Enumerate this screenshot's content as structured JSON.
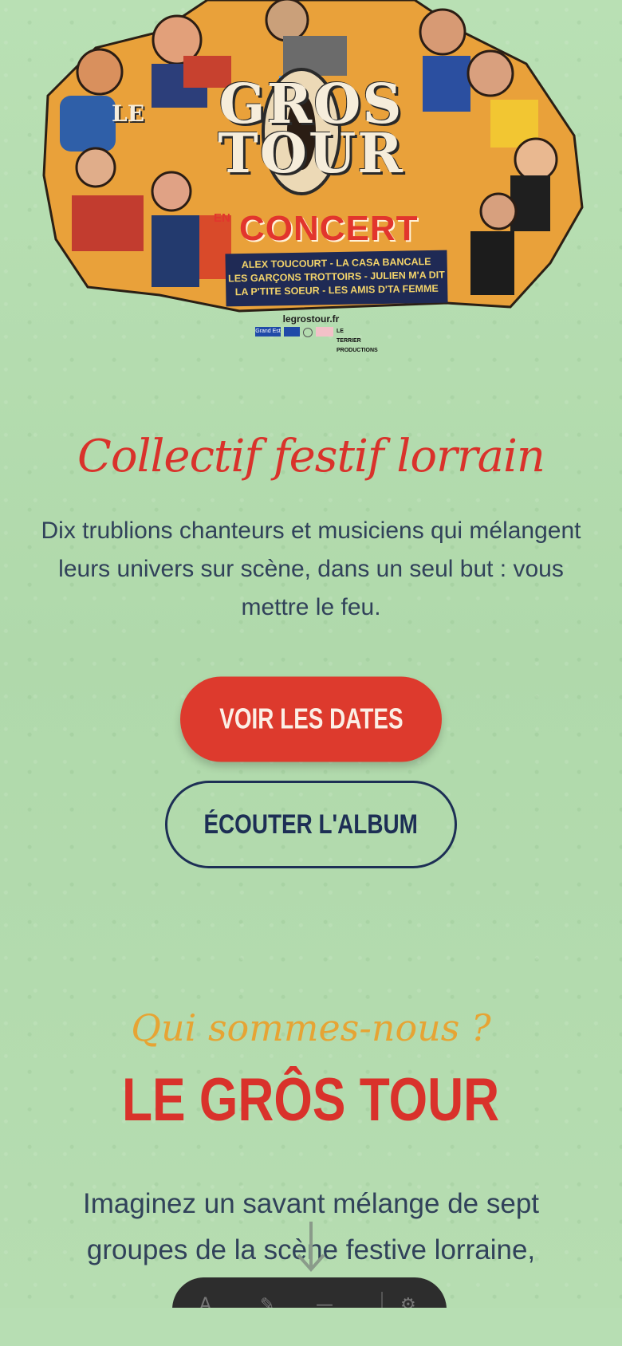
{
  "poster": {
    "title_le": "LE",
    "title_line1": "GROS",
    "title_line2": "TOUR",
    "concert_en": "EN",
    "concert": "CONCERT",
    "bands": [
      "ALEX TOUCOURT  -  LA CASA BANCALE",
      "LES GARÇONS TROTTOIRS  -  JULIEN M'A DIT",
      "LA P'TITE SOEUR  -  LES AMIS D'TA FEMME"
    ],
    "site": "legrostour.fr",
    "partner_logos": [
      "Grand Est",
      "LE TERRIER PRODUCTIONS"
    ]
  },
  "hero": {
    "tagline": "Collectif festif lorrain",
    "intro": "Dix trublions chanteurs et musiciens qui mélangent leurs univers sur scène, dans un seul but : vous mettre le feu.",
    "primary_button": "VOIR LES DATES",
    "secondary_button": "ÉCOUTER L'ALBUM"
  },
  "about": {
    "kicker": "Qui sommes-nous ?",
    "title": "LE GRÔS TOUR",
    "text": "Imaginez un savant mélange de sept groupes de la scène festive lorraine, réunis ... u. Dix"
  },
  "colors": {
    "background": "#b5ddb1",
    "accent_red": "#dd3a2d",
    "navy": "#1d2f55",
    "gold": "#e6a434",
    "body_text": "#31425a"
  },
  "icons": {
    "scroll": "arrow-down-icon",
    "dock": [
      "text-icon",
      "brush-icon",
      "minus-icon",
      "settings-icon"
    ]
  }
}
